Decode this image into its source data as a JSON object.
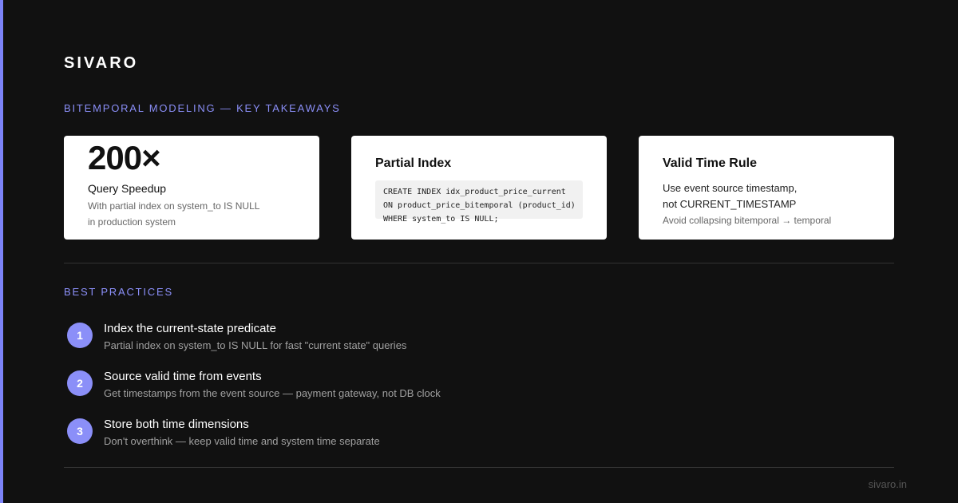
{
  "brand": "SIVARO",
  "colors": {
    "background": "#111111",
    "accent": "#8b8ff8",
    "accent_bar": "#7c83f7",
    "card": "#ffffff"
  },
  "takeaways": {
    "label": "BITEMPORAL MODELING — KEY TAKEAWAYS",
    "cards": [
      {
        "stat": "200×",
        "title": "Query Speedup",
        "desc_lines": [
          "With partial index on system_to IS NULL",
          "in production system"
        ]
      },
      {
        "title": "Partial Index",
        "code_lines": [
          "CREATE INDEX idx_product_price_current",
          "ON product_price_bitemporal (product_id)",
          "WHERE system_to IS NULL;"
        ]
      },
      {
        "title": "Valid Time Rule",
        "body_lines": [
          "Use event source timestamp,",
          "not CURRENT_TIMESTAMP"
        ],
        "note": "Avoid collapsing bitemporal → temporal"
      }
    ]
  },
  "best_practices": {
    "label": "BEST PRACTICES",
    "items": [
      {
        "num": "1",
        "title": "Index the current-state predicate",
        "desc": "Partial index on system_to IS NULL for fast \"current state\" queries"
      },
      {
        "num": "2",
        "title": "Source valid time from events",
        "desc": "Get timestamps from the event source — payment gateway, not DB clock"
      },
      {
        "num": "3",
        "title": "Store both time dimensions",
        "desc": "Don't overthink — keep valid time and system time separate"
      }
    ]
  },
  "footer": {
    "url": "sivaro.in"
  }
}
